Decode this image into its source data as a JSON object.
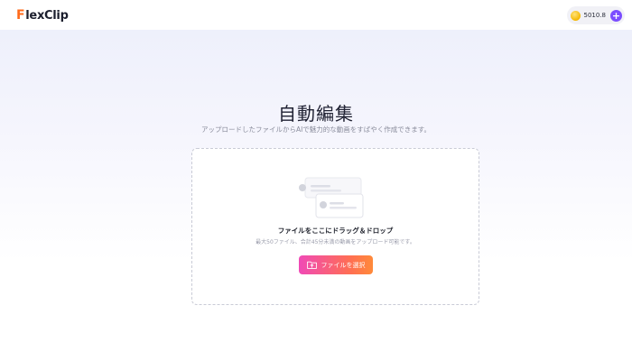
{
  "header": {
    "logo_mark": "F",
    "logo_text": "lexClip",
    "credits": "5010.8",
    "plus_symbol": "+"
  },
  "main": {
    "title": "自動編集",
    "subtitle": "アップロードしたファイルからAIで魅力的な動画をすばやく作成できます。"
  },
  "dropzone": {
    "label": "ファイルをここにドラッグ＆ドロップ",
    "hint": "最大50ファイル、合計45分未満の動画をアップロード可能です。",
    "button_label": "ファイルを選択"
  },
  "colors": {
    "brand_orange": "#ff6a1a",
    "accent_purple": "#7b4dff",
    "button_gradient_start": "#f04ab6",
    "button_gradient_end": "#ff8a3a"
  },
  "icons": [
    "flexclip-logo-icon",
    "coin-icon",
    "plus-icon",
    "upload-illustration-icon",
    "folder-upload-icon"
  ]
}
